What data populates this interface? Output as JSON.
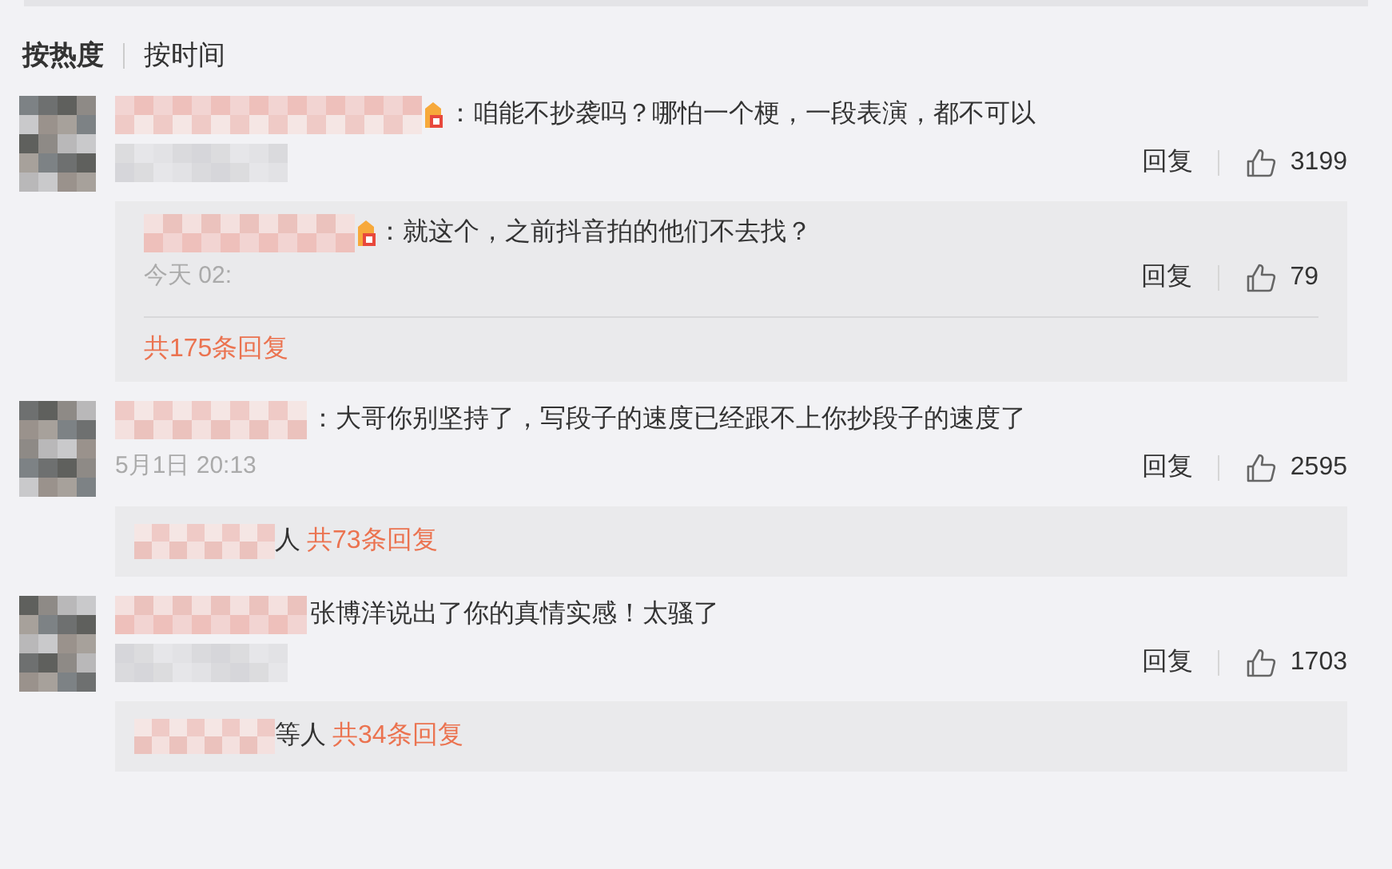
{
  "tabs": [
    {
      "label": "按热度",
      "selected": true
    },
    {
      "label": "按时间",
      "selected": false
    }
  ],
  "comments": [
    {
      "badge": true,
      "text": "：咱能不抄袭吗？哪怕一个梗，一段表演，都不可以",
      "reply_label": "回复",
      "likes": "3199",
      "thread": {
        "kind": "reply",
        "badge": true,
        "text": "：就这个，之前抖音拍的他们不去找？",
        "time": "今天 02:",
        "reply_label": "回复",
        "likes": "79",
        "total": "共175条回复"
      }
    },
    {
      "badge": false,
      "text": "：大哥你别坚持了，写段子的速度已经跟不上你抄段子的速度了",
      "time": "5月1日 20:13",
      "reply_label": "回复",
      "likes": "2595",
      "thread": {
        "kind": "summary",
        "suffix": "人",
        "total": "共73条回复"
      }
    },
    {
      "badge": false,
      "text": "张博洋说出了你的真情实感！太骚了",
      "reply_label": "回复",
      "likes": "1703",
      "thread": {
        "kind": "summary",
        "suffix": "等人",
        "total": "共34条回复"
      }
    }
  ]
}
